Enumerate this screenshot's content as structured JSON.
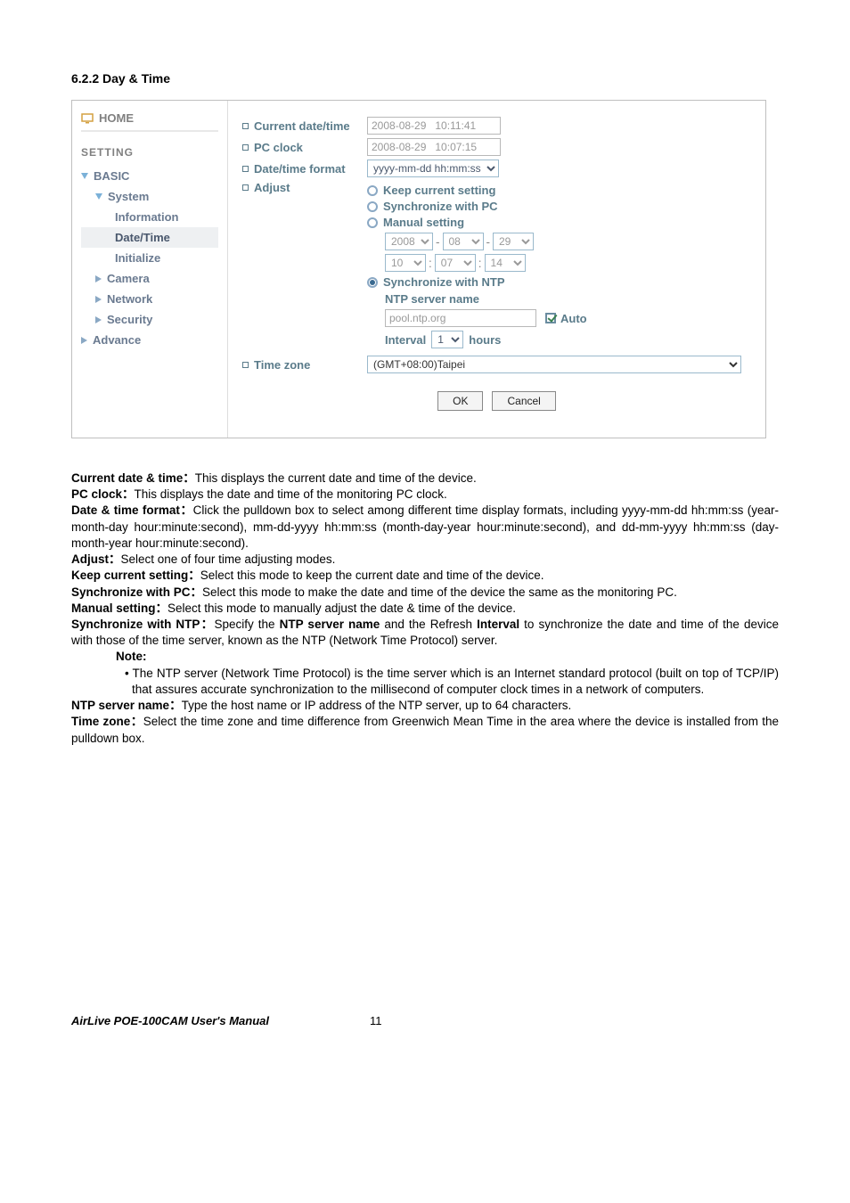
{
  "heading": "6.2.2 Day & Time",
  "sidebar": {
    "home": "HOME",
    "setting": "SETTING",
    "basic": "BASIC",
    "system": "System",
    "information": "Information",
    "datetime": "Date/Time",
    "initialize": "Initialize",
    "camera": "Camera",
    "network": "Network",
    "security": "Security",
    "advance": "Advance"
  },
  "form": {
    "current_date_label": "Current date/time",
    "current_date_value": "2008-08-29   10:11:41",
    "pc_clock_label": "PC clock",
    "pc_clock_value": "2008-08-29   10:07:15",
    "datefmt_label": "Date/time format",
    "datefmt_value": "yyyy-mm-dd hh:mm:ss",
    "adjust_label": "Adjust",
    "keep_current": "Keep current setting",
    "sync_pc": "Synchronize with PC",
    "manual": "Manual setting",
    "year": "2008",
    "month": "08",
    "day": "29",
    "hour": "10",
    "minute": "07",
    "second": "14",
    "sync_ntp": "Synchronize with NTP",
    "ntp_server_name": "NTP server name",
    "ntp_server_value": "pool.ntp.org",
    "auto": "Auto",
    "interval_label": "Interval",
    "interval_value": "1",
    "hours": "hours",
    "timezone_label": "Time zone",
    "timezone_value": "(GMT+08:00)Taipei",
    "ok": "OK",
    "cancel": "Cancel"
  },
  "body": {
    "p1a": "Current date & time：",
    "p1b": "This displays the current date and time of the device.",
    "p2a": "PC clock：",
    "p2b": "This displays the date and time of the monitoring PC clock.",
    "p3a": "Date & time format：",
    "p3b": "Click the pulldown box to select among different time display formats, including yyyy-mm-dd hh:mm:ss (year-month-day hour:minute:second), mm-dd-yyyy hh:mm:ss (month-day-year hour:minute:second), and dd-mm-yyyy hh:mm:ss (day-month-year hour:minute:second).",
    "p4a": "Adjust：",
    "p4b": "Select one of four time adjusting modes.",
    "p5a": "Keep current setting：",
    "p5b": "Select this mode to keep the current date and time of the device.",
    "p6a": "Synchronize with PC：",
    "p6b": "Select this mode to make the date and time of the device the same as the monitoring PC.",
    "p7a": "Manual setting：",
    "p7b": "Select this mode to manually adjust the date & time of the device.",
    "p8a": "Synchronize with NTP：",
    "p8b": "Specify the ",
    "p8c": "NTP server name",
    "p8d": " and the Refresh ",
    "p8e": "Interval",
    "p8f": " to synchronize the date and time of the device with those of the time server, known as the NTP (Network Time Protocol) server.",
    "note": "Note:",
    "bullet": "• The NTP server (Network Time Protocol) is the time server which is an Internet standard protocol (built on top of TCP/IP) that assures accurate synchronization to the millisecond of computer clock times in a network of computers.",
    "p9a": "NTP server name：",
    "p9b": "Type the host name or IP address of the NTP server, up to 64 characters.",
    "p10a": "Time zone：",
    "p10b": "Select the time zone and time difference from Greenwich Mean Time in the area where the device is installed from the pulldown box."
  },
  "footer": {
    "title": "AirLive POE-100CAM User's Manual",
    "page": "11"
  }
}
